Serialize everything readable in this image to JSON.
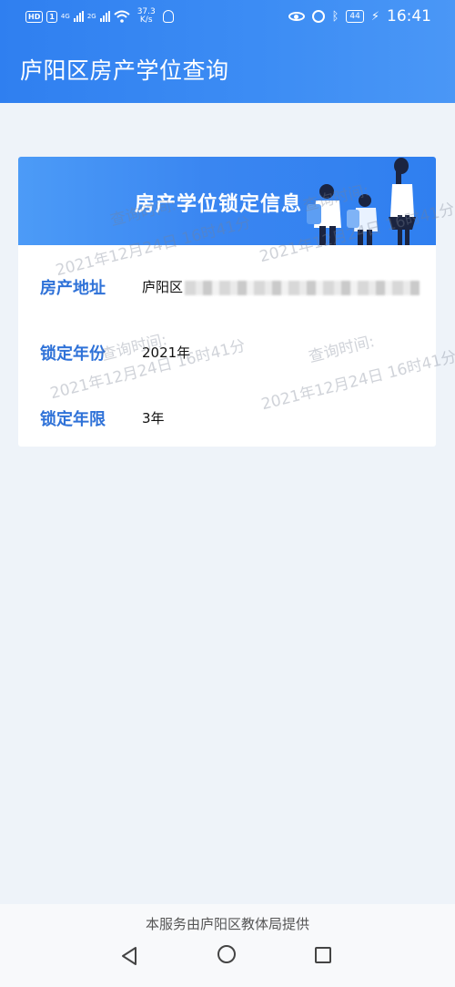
{
  "status_bar": {
    "hd_badge": "HD",
    "sim1": "1",
    "net1": "4G",
    "net2": "2G",
    "speed_value": "37.3",
    "speed_unit": "K/s",
    "battery": "44",
    "time": "16:41"
  },
  "app": {
    "title": "庐阳区房产学位查询"
  },
  "card": {
    "banner_title": "房产学位锁定信息",
    "rows": [
      {
        "label": "房产地址",
        "value": "庐阳区"
      },
      {
        "label": "锁定年份",
        "value": "2021年"
      },
      {
        "label": "锁定年限",
        "value": "3年"
      }
    ],
    "watermark_label": "查询时间:",
    "watermark_time": "2021年12月24日 16时41分"
  },
  "footer": {
    "provider_text": "本服务由庐阳区教体局提供"
  },
  "icons": [
    "eye-icon",
    "alarm-icon",
    "bluetooth-icon",
    "battery-icon",
    "charging-icon",
    "wifi-icon",
    "bulb-icon",
    "back-icon",
    "home-icon",
    "recent-apps-icon"
  ],
  "colors": {
    "primary": "#2f7ff0",
    "label_blue": "#2f72d8",
    "background": "#eef3f9"
  }
}
